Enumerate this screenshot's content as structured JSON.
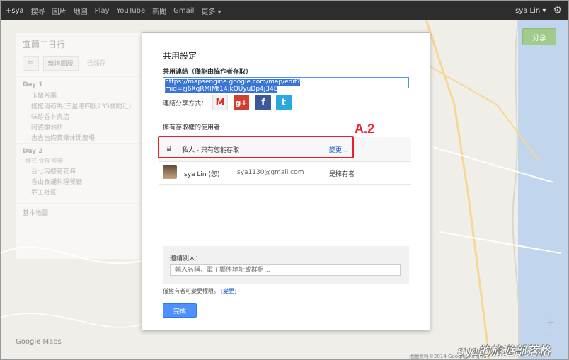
{
  "gbar": {
    "links": [
      "+sya",
      "搜尋",
      "圖片",
      "地圖",
      "Play",
      "YouTube",
      "新聞",
      "Gmail",
      "更多 ▾"
    ],
    "user": "sya Lin ▾"
  },
  "map": {
    "share_label": "分享",
    "zoom_in": "+",
    "zoom_out": "−",
    "logo": "Google Maps",
    "copyright": "地圖資料©2014 Google, Kingway"
  },
  "left_panel": {
    "title": "宜蘭二日行",
    "add_layer": "新增圖層",
    "saved": "已儲存",
    "day1": "Day 1",
    "day1_items": [
      "玉蘭茶園",
      "搖搖消荷馬(三星路四段235號附近)",
      "味珍香卜肉店",
      "阿婆酸油餅",
      "古古古掬寶樂休閒農場"
    ],
    "day2": "Day 2",
    "day2_sub": "樣式  資料  標籤",
    "day2_items": [
      "台七丙櫻花花海",
      "香山食舖料理餐廳",
      "罪王社区"
    ],
    "footer": "基本地圖"
  },
  "dialog": {
    "title": "共用設定",
    "link_label": "共用連結（僅能由協作者存取）",
    "link_value": "https://mapsengine.google.com/map/edit?mid=zj6XqRMlMt14.kQUyuDp4j34E",
    "share_via": "連結分享方式：",
    "access_label": "擁有存取權的使用者",
    "private_text": "私人 - 只有您能存取",
    "change_link": "變更...",
    "user_name": "sya Lin (您)",
    "user_email": "sya1130@gmail.com",
    "user_role": "是擁有者",
    "invite_label": "邀請別人：",
    "invite_placeholder": "輸入名稱、電子郵件地址或群組...",
    "owner_note": "僅擁有者可變更權限。",
    "owner_note_link": "[變更]",
    "done_label": "完成"
  },
  "annotation": {
    "label": "A.2",
    "color": "#e8202a"
  },
  "watermark": "sya的旅遊部落格",
  "colors": {
    "primary_blue": "#4d90fe",
    "share_green": "#7fb85f",
    "gbar_bg": "#2d2d2d"
  }
}
